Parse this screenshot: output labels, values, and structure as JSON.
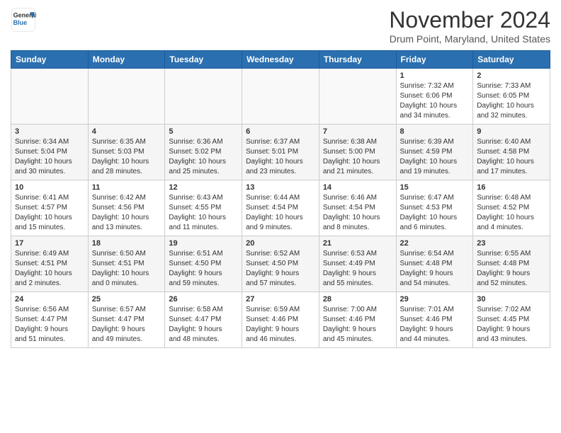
{
  "logo": {
    "general": "General",
    "blue": "Blue"
  },
  "title": "November 2024",
  "location": "Drum Point, Maryland, United States",
  "days_of_week": [
    "Sunday",
    "Monday",
    "Tuesday",
    "Wednesday",
    "Thursday",
    "Friday",
    "Saturday"
  ],
  "weeks": [
    [
      {
        "day": "",
        "info": ""
      },
      {
        "day": "",
        "info": ""
      },
      {
        "day": "",
        "info": ""
      },
      {
        "day": "",
        "info": ""
      },
      {
        "day": "",
        "info": ""
      },
      {
        "day": "1",
        "info": "Sunrise: 7:32 AM\nSunset: 6:06 PM\nDaylight: 10 hours\nand 34 minutes."
      },
      {
        "day": "2",
        "info": "Sunrise: 7:33 AM\nSunset: 6:05 PM\nDaylight: 10 hours\nand 32 minutes."
      }
    ],
    [
      {
        "day": "3",
        "info": "Sunrise: 6:34 AM\nSunset: 5:04 PM\nDaylight: 10 hours\nand 30 minutes."
      },
      {
        "day": "4",
        "info": "Sunrise: 6:35 AM\nSunset: 5:03 PM\nDaylight: 10 hours\nand 28 minutes."
      },
      {
        "day": "5",
        "info": "Sunrise: 6:36 AM\nSunset: 5:02 PM\nDaylight: 10 hours\nand 25 minutes."
      },
      {
        "day": "6",
        "info": "Sunrise: 6:37 AM\nSunset: 5:01 PM\nDaylight: 10 hours\nand 23 minutes."
      },
      {
        "day": "7",
        "info": "Sunrise: 6:38 AM\nSunset: 5:00 PM\nDaylight: 10 hours\nand 21 minutes."
      },
      {
        "day": "8",
        "info": "Sunrise: 6:39 AM\nSunset: 4:59 PM\nDaylight: 10 hours\nand 19 minutes."
      },
      {
        "day": "9",
        "info": "Sunrise: 6:40 AM\nSunset: 4:58 PM\nDaylight: 10 hours\nand 17 minutes."
      }
    ],
    [
      {
        "day": "10",
        "info": "Sunrise: 6:41 AM\nSunset: 4:57 PM\nDaylight: 10 hours\nand 15 minutes."
      },
      {
        "day": "11",
        "info": "Sunrise: 6:42 AM\nSunset: 4:56 PM\nDaylight: 10 hours\nand 13 minutes."
      },
      {
        "day": "12",
        "info": "Sunrise: 6:43 AM\nSunset: 4:55 PM\nDaylight: 10 hours\nand 11 minutes."
      },
      {
        "day": "13",
        "info": "Sunrise: 6:44 AM\nSunset: 4:54 PM\nDaylight: 10 hours\nand 9 minutes."
      },
      {
        "day": "14",
        "info": "Sunrise: 6:46 AM\nSunset: 4:54 PM\nDaylight: 10 hours\nand 8 minutes."
      },
      {
        "day": "15",
        "info": "Sunrise: 6:47 AM\nSunset: 4:53 PM\nDaylight: 10 hours\nand 6 minutes."
      },
      {
        "day": "16",
        "info": "Sunrise: 6:48 AM\nSunset: 4:52 PM\nDaylight: 10 hours\nand 4 minutes."
      }
    ],
    [
      {
        "day": "17",
        "info": "Sunrise: 6:49 AM\nSunset: 4:51 PM\nDaylight: 10 hours\nand 2 minutes."
      },
      {
        "day": "18",
        "info": "Sunrise: 6:50 AM\nSunset: 4:51 PM\nDaylight: 10 hours\nand 0 minutes."
      },
      {
        "day": "19",
        "info": "Sunrise: 6:51 AM\nSunset: 4:50 PM\nDaylight: 9 hours\nand 59 minutes."
      },
      {
        "day": "20",
        "info": "Sunrise: 6:52 AM\nSunset: 4:50 PM\nDaylight: 9 hours\nand 57 minutes."
      },
      {
        "day": "21",
        "info": "Sunrise: 6:53 AM\nSunset: 4:49 PM\nDaylight: 9 hours\nand 55 minutes."
      },
      {
        "day": "22",
        "info": "Sunrise: 6:54 AM\nSunset: 4:48 PM\nDaylight: 9 hours\nand 54 minutes."
      },
      {
        "day": "23",
        "info": "Sunrise: 6:55 AM\nSunset: 4:48 PM\nDaylight: 9 hours\nand 52 minutes."
      }
    ],
    [
      {
        "day": "24",
        "info": "Sunrise: 6:56 AM\nSunset: 4:47 PM\nDaylight: 9 hours\nand 51 minutes."
      },
      {
        "day": "25",
        "info": "Sunrise: 6:57 AM\nSunset: 4:47 PM\nDaylight: 9 hours\nand 49 minutes."
      },
      {
        "day": "26",
        "info": "Sunrise: 6:58 AM\nSunset: 4:47 PM\nDaylight: 9 hours\nand 48 minutes."
      },
      {
        "day": "27",
        "info": "Sunrise: 6:59 AM\nSunset: 4:46 PM\nDaylight: 9 hours\nand 46 minutes."
      },
      {
        "day": "28",
        "info": "Sunrise: 7:00 AM\nSunset: 4:46 PM\nDaylight: 9 hours\nand 45 minutes."
      },
      {
        "day": "29",
        "info": "Sunrise: 7:01 AM\nSunset: 4:46 PM\nDaylight: 9 hours\nand 44 minutes."
      },
      {
        "day": "30",
        "info": "Sunrise: 7:02 AM\nSunset: 4:45 PM\nDaylight: 9 hours\nand 43 minutes."
      }
    ]
  ]
}
